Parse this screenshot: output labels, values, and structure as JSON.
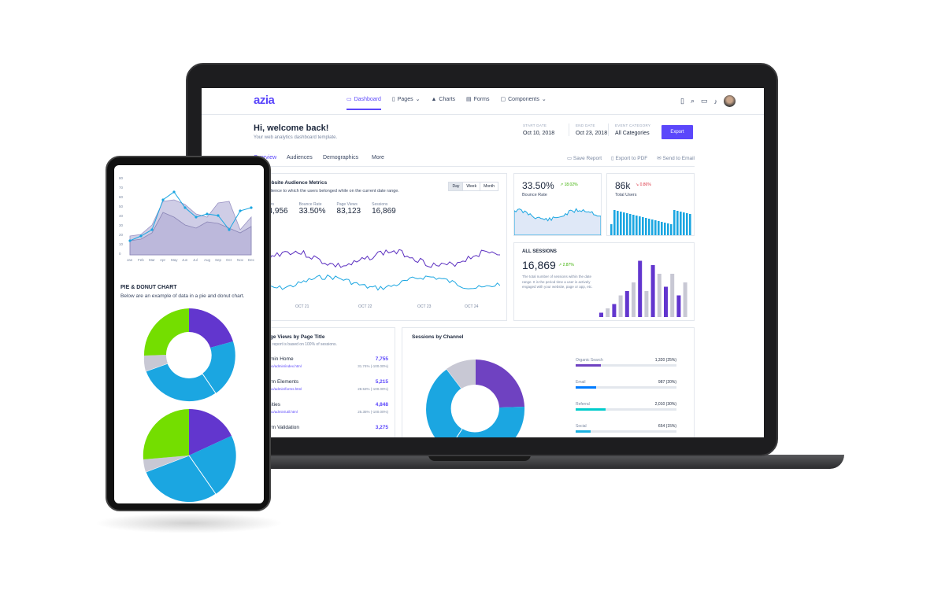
{
  "header": {
    "logo": "azia",
    "nav": [
      {
        "label": "Dashboard",
        "active": true,
        "icon": "dashboard-icon"
      },
      {
        "label": "Pages",
        "dropdown": true,
        "icon": "file-icon"
      },
      {
        "label": "Charts",
        "icon": "chart-icon"
      },
      {
        "label": "Forms",
        "icon": "forms-icon"
      },
      {
        "label": "Components",
        "dropdown": true,
        "icon": "components-icon"
      }
    ]
  },
  "welcome": {
    "title": "Hi, welcome back!",
    "subtitle": "Your web analytics dashboard template."
  },
  "filters": {
    "start_label": "START DATE",
    "start_value": "Oct 10, 2018",
    "end_label": "END DATE",
    "end_value": "Oct 23, 2018",
    "category_label": "EVENT CATEGORY",
    "category_value": "All Categories",
    "export_label": "Export"
  },
  "tabs": [
    "Overview",
    "Audiences",
    "Demographics",
    "More"
  ],
  "tab_actions": [
    "Save Report",
    "Export to PDF",
    "Send to Email"
  ],
  "audience": {
    "title": "Website Audience Metrics",
    "subtitle": "Audience to which the users belonged while on the current date range.",
    "toggles": [
      "Day",
      "Week",
      "Month"
    ],
    "metrics": [
      {
        "label": "Users",
        "value": "44,956"
      },
      {
        "label": "Bounce Rate",
        "value": "33.50%"
      },
      {
        "label": "Page Views",
        "value": "83,123"
      },
      {
        "label": "Sessions",
        "value": "16,869"
      }
    ],
    "xlabels": [
      "OCT 21",
      "OCT 22",
      "OCT 23",
      "OCT 24"
    ]
  },
  "bounce": {
    "value": "33.50%",
    "change": "18.02%",
    "label": "Bounce Rate"
  },
  "users": {
    "value": "86k",
    "change": "0.86%",
    "label": "Total Users"
  },
  "sessions": {
    "title": "ALL SESSIONS",
    "value": "16,869",
    "change": "2.87%",
    "desc": "The total number of sessions within the date range. It is the period time a user is actively engaged with your website, page or app, etc.",
    "bars": [
      1,
      2,
      3,
      5,
      6,
      8,
      13,
      6,
      12,
      10,
      7,
      10,
      5,
      8
    ]
  },
  "pageviews": {
    "title": "Page Views by Page Title",
    "subtitle": "This report is based on 100% of sessions.",
    "rows": [
      {
        "title": "Admin Home",
        "url": "/demo/admin/index.html",
        "value": "7,755",
        "pct": "31.74% (-100.00%)"
      },
      {
        "title": "Form Elements",
        "url": "/demo/admin/forms.html",
        "value": "5,215",
        "pct": "28.53% (-100.00%)"
      },
      {
        "title": "Utilities",
        "url": "/demo/admin/util.html",
        "value": "4,848",
        "pct": "25.35% (-100.00%)"
      },
      {
        "title": "Form Validation",
        "url": "",
        "value": "3,275",
        "pct": ""
      }
    ]
  },
  "channels": {
    "title": "Sessions by Channel",
    "rows": [
      {
        "label": "Organic Search",
        "value": "1,320 (25%)",
        "pct": 0.25,
        "color": "#6f42c1"
      },
      {
        "label": "Email",
        "value": "987 (20%)",
        "pct": 0.2,
        "color": "#007bff"
      },
      {
        "label": "Referral",
        "value": "2,010 (30%)",
        "pct": 0.3,
        "color": "#00cccc"
      },
      {
        "label": "Social",
        "value": "654 (15%)",
        "pct": 0.15,
        "color": "#1bb1e0"
      }
    ]
  },
  "phone": {
    "yticks": [
      "80",
      "70",
      "60",
      "50",
      "40",
      "30",
      "20",
      "10",
      "0"
    ],
    "months": [
      "Jan",
      "Feb",
      "Mar",
      "Apr",
      "May",
      "Jun",
      "Jul",
      "Aug",
      "Sep",
      "Oct",
      "Nov",
      "Dec"
    ],
    "pie_title": "PIE & DONUT CHART",
    "pie_subtitle": "Below are an example of data in a pie and donut chart."
  },
  "colors": {
    "accent": "#5b47fb",
    "purple": "#6f42c1",
    "blue": "#1ba6e1",
    "green": "#74de00",
    "grey": "#c8c8d4"
  }
}
